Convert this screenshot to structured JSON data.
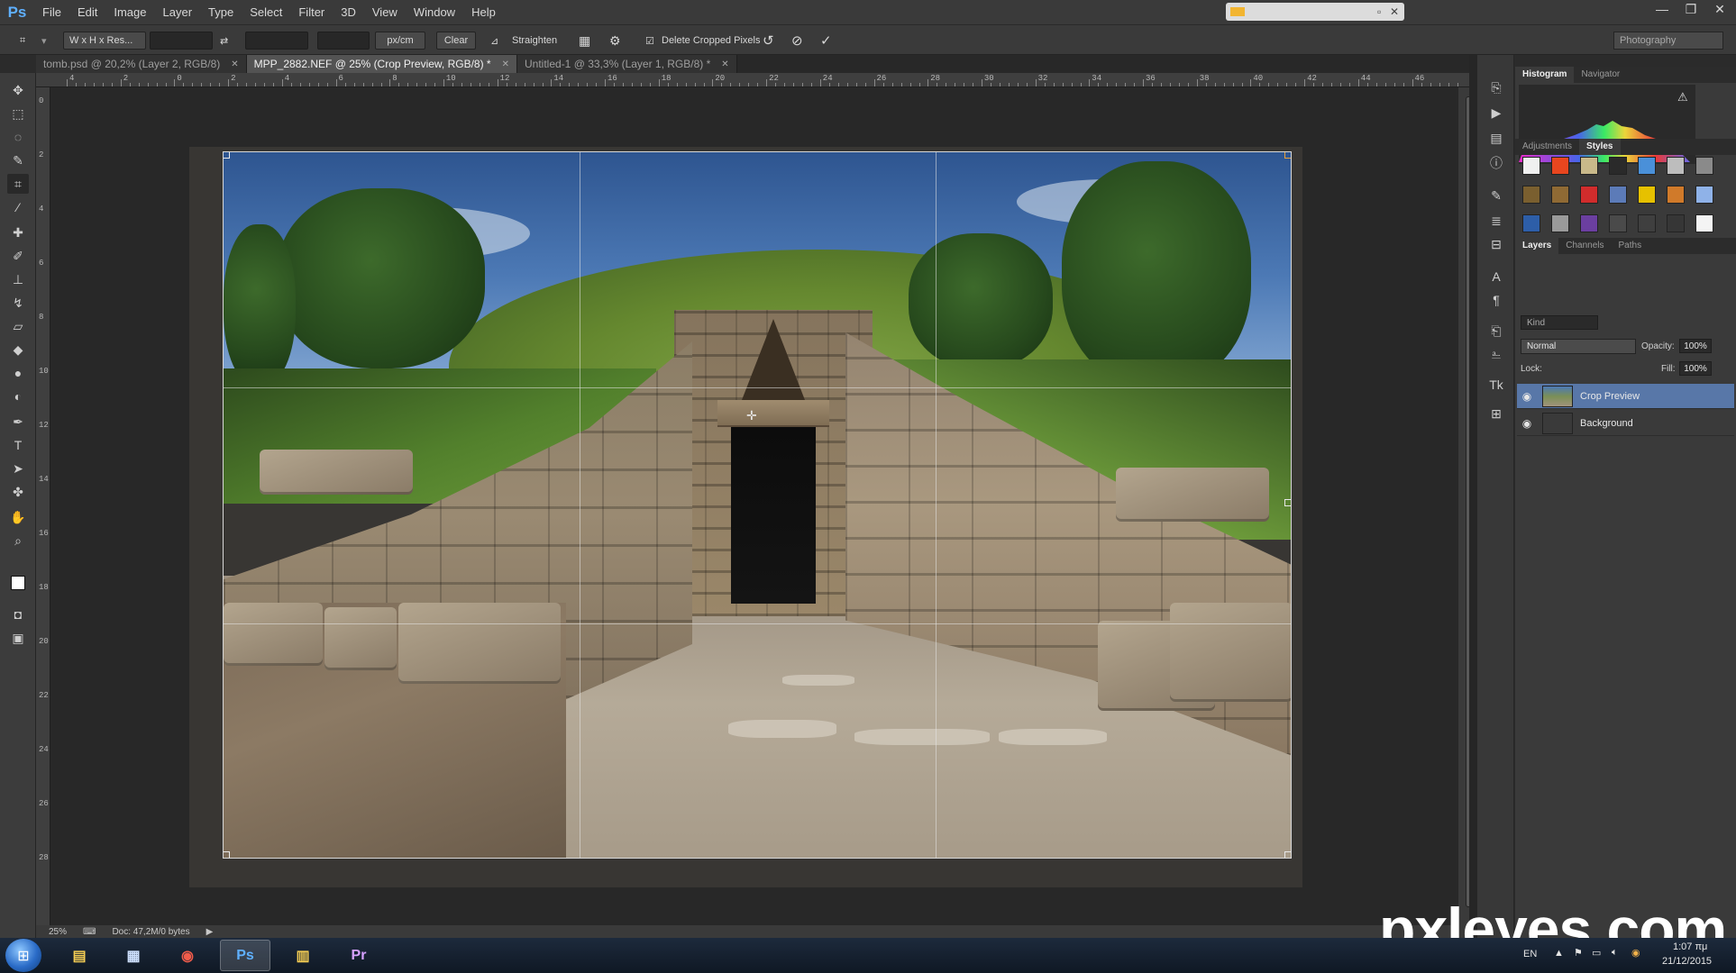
{
  "app": {
    "logo": "Ps",
    "menu": [
      "File",
      "Edit",
      "Image",
      "Layer",
      "Type",
      "Select",
      "Filter",
      "3D",
      "View",
      "Window",
      "Help"
    ]
  },
  "window_controls": {
    "minimize": "—",
    "restore": "❐",
    "close": "✕"
  },
  "options_bar": {
    "ratio_preset": "W x H x Res...",
    "unit": "px/cm",
    "clear_label": "Clear",
    "straighten_label": "Straighten",
    "delete_cropped_label": "Delete Cropped Pixels",
    "delete_cropped_checked": true,
    "workspace": "Photography"
  },
  "tabs": [
    {
      "label": "tomb.psd @ 20,2% (Layer 2, RGB/8)",
      "active": false
    },
    {
      "label": "MPP_2882.NEF @ 25% (Crop Preview, RGB/8) *",
      "active": true
    },
    {
      "label": "Untitled-1 @ 33,3% (Layer 1, RGB/8) *",
      "active": false
    }
  ],
  "ruler_top": [
    "4",
    "2",
    "0",
    "2",
    "4",
    "6",
    "8",
    "10",
    "12",
    "14",
    "16",
    "18",
    "20",
    "22",
    "24",
    "26",
    "28",
    "30",
    "32",
    "34",
    "36",
    "38",
    "40",
    "42",
    "44",
    "46"
  ],
  "ruler_left": [
    "0",
    "2",
    "4",
    "6",
    "8",
    "10",
    "12",
    "14",
    "16",
    "18",
    "20",
    "22",
    "24",
    "26",
    "28"
  ],
  "statusbar": {
    "zoom": "25%",
    "doc": "Doc: 47,2M/0 bytes"
  },
  "panels": {
    "top_tabs": [
      "Histogram",
      "Navigator"
    ],
    "style_tabs": [
      "Adjustments",
      "Styles"
    ],
    "layer_tabs": [
      "Layers",
      "Channels",
      "Paths"
    ],
    "kind_filter": "Kind",
    "blend_mode": "Normal",
    "opacity_label": "Opacity:",
    "opacity_value": "100%",
    "lock_label": "Lock:",
    "fill_label": "Fill:",
    "fill_value": "100%",
    "layers": [
      {
        "name": "Crop Preview",
        "active": true
      },
      {
        "name": "Background",
        "active": false
      }
    ],
    "histogram_warning": "⚠"
  },
  "style_swatch_colors": [
    "#f0f0f0",
    "#e8461f",
    "#c9b98a",
    "#2a2a2a",
    "#4a90d9",
    "#bdbdbd",
    "#8a8a8a",
    "#7a5f2f",
    "#8f6a34",
    "#d12c2c",
    "#5c7bb8",
    "#e6c100",
    "#d07a2a",
    "#8fb2e8",
    "#2d5ea8",
    "#9a9a9a",
    "#6b3fa0",
    "#4a4a4a",
    "#3f3f3f",
    "#363636",
    "#f4f4f4"
  ],
  "taskbar": {
    "apps": [
      {
        "name": "Windows Explorer",
        "glyph": "▤"
      },
      {
        "name": "Calculator",
        "glyph": "▦"
      },
      {
        "name": "Chrome",
        "glyph": "◉"
      },
      {
        "name": "Photoshop",
        "glyph": "Ps"
      },
      {
        "name": "File Explorer",
        "glyph": "▥"
      },
      {
        "name": "Premiere",
        "glyph": "Pr"
      }
    ],
    "lang": "EN",
    "time": "1:07 πμ",
    "date": "21/12/2015"
  },
  "watermark": "pxleyes.com",
  "colors": {
    "accent": "#5877a8",
    "ps_blue": "#5fb0ff",
    "pr_purple": "#d6a1ff"
  }
}
